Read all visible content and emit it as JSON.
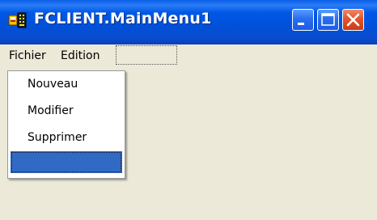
{
  "window": {
    "title": "FCLIENT.MainMenu1",
    "app_icon": "delphi-form-icon"
  },
  "title_buttons": {
    "minimize_icon": "minimize-icon",
    "maximize_icon": "maximize-icon",
    "close_icon": "close-icon"
  },
  "menubar": {
    "items": [
      {
        "label": "Fichier"
      },
      {
        "label": "Edition"
      }
    ],
    "placeholder_label": ""
  },
  "dropdown": {
    "items": [
      {
        "label": "Nouveau"
      },
      {
        "label": "Modifier"
      },
      {
        "label": "Supprimer"
      },
      {
        "label": ""
      }
    ],
    "selected_index": 3
  },
  "colors": {
    "title_bar": "#0054e3",
    "window_bg": "#ece9d8",
    "selection": "#316ac5",
    "close_button": "#e2542b"
  }
}
